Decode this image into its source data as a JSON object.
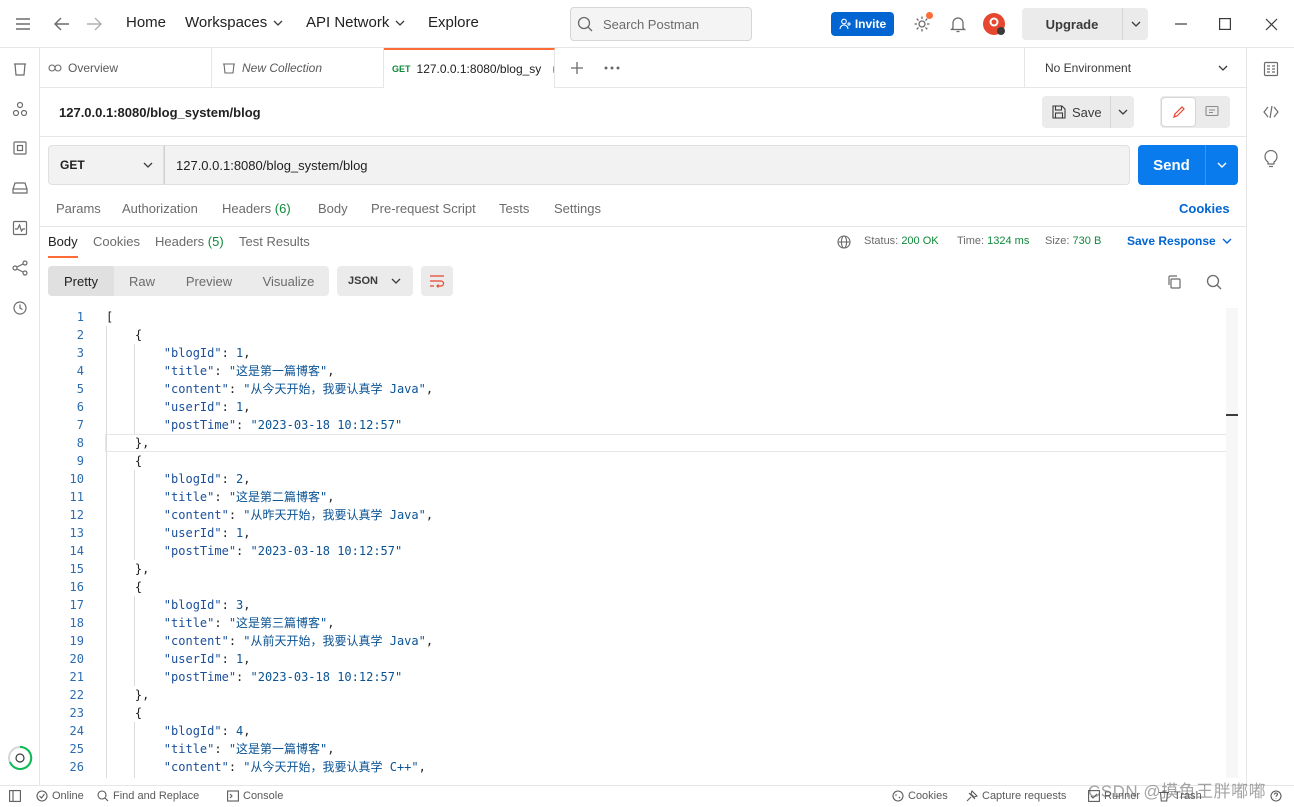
{
  "titlebar": {
    "nav": [
      "Home",
      "Workspaces",
      "API Network",
      "Explore"
    ],
    "search_placeholder": "Search Postman",
    "invite_label": "Invite",
    "upgrade_label": "Upgrade",
    "accent_color": "#ff6c37",
    "invite_color": "#0265d2"
  },
  "tabs": {
    "overview": "Overview",
    "new_collection": "New Collection",
    "active_method": "GET",
    "active_label": "127.0.0.1:8080/blog_sy",
    "environment": "No Environment"
  },
  "request": {
    "title": "127.0.0.1:8080/blog_system/blog",
    "save_label": "Save",
    "method": "GET",
    "url": "127.0.0.1:8080/blog_system/blog",
    "send_label": "Send",
    "send_color": "#097bed",
    "subtabs": {
      "params": "Params",
      "authorization": "Authorization",
      "headers": "Headers",
      "headers_count": "(6)",
      "body": "Body",
      "prerequest": "Pre-request Script",
      "tests": "Tests",
      "settings": "Settings"
    },
    "cookies_link": "Cookies"
  },
  "response": {
    "tabs": {
      "body": "Body",
      "cookies": "Cookies",
      "headers": "Headers",
      "headers_count": "(5)",
      "test_results": "Test Results"
    },
    "status_label": "Status:",
    "status_value": "200 OK",
    "time_label": "Time:",
    "time_value": "1324 ms",
    "size_label": "Size:",
    "size_value": "730 B",
    "save_response": "Save Response",
    "views": [
      "Pretty",
      "Raw",
      "Preview",
      "Visualize"
    ],
    "active_view": "Pretty",
    "language": "JSON"
  },
  "code": {
    "keys": {
      "blogId": "\"blogId\"",
      "title": "\"title\"",
      "content": "\"content\"",
      "userId": "\"userId\"",
      "postTime": "\"postTime\""
    },
    "records": [
      {
        "blogId": "1",
        "title": "\"这是第一篇博客\"",
        "content": "\"从今天开始，我要认真学 Java\"",
        "userId": "1",
        "postTime": "\"2023-03-18 10:12:57\""
      },
      {
        "blogId": "2",
        "title": "\"这是第二篇博客\"",
        "content": "\"从昨天开始，我要认真学 Java\"",
        "userId": "1",
        "postTime": "\"2023-03-18 10:12:57\""
      },
      {
        "blogId": "3",
        "title": "\"这是第三篇博客\"",
        "content": "\"从前天开始，我要认真学 Java\"",
        "userId": "1",
        "postTime": "\"2023-03-18 10:12:57\""
      },
      {
        "blogId": "4",
        "title": "\"这是第一篇博客\"",
        "content": "\"从今天开始，我要认真学 C++\""
      }
    ],
    "line_numbers": [
      "1",
      "2",
      "3",
      "4",
      "5",
      "6",
      "7",
      "8",
      "9",
      "10",
      "11",
      "12",
      "13",
      "14",
      "15",
      "16",
      "17",
      "18",
      "19",
      "20",
      "21",
      "22",
      "23",
      "24",
      "25",
      "26"
    ]
  },
  "statusbar": {
    "online": "Online",
    "find_replace": "Find and Replace",
    "console": "Console",
    "cookies": "Cookies",
    "capture": "Capture requests",
    "runner": "Runner",
    "trash": "Trash"
  },
  "watermark": "CSDN @摸鱼王胖嘟嘟"
}
